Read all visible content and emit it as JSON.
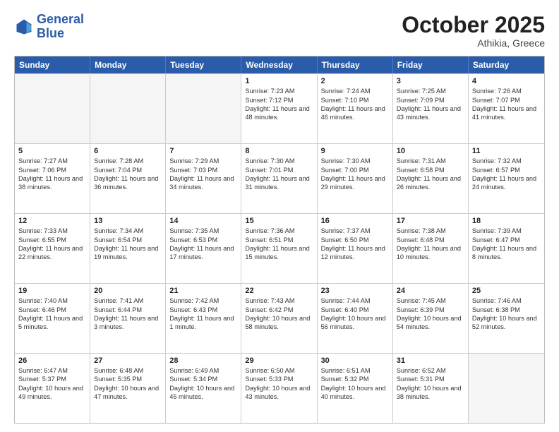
{
  "header": {
    "logo_line1": "General",
    "logo_line2": "Blue",
    "month": "October 2025",
    "location": "Athikia, Greece"
  },
  "days_of_week": [
    "Sunday",
    "Monday",
    "Tuesday",
    "Wednesday",
    "Thursday",
    "Friday",
    "Saturday"
  ],
  "rows": [
    [
      {
        "day": "",
        "empty": true
      },
      {
        "day": "",
        "empty": true
      },
      {
        "day": "",
        "empty": true
      },
      {
        "day": "1",
        "sunrise": "Sunrise: 7:23 AM",
        "sunset": "Sunset: 7:12 PM",
        "daylight": "Daylight: 11 hours and 48 minutes."
      },
      {
        "day": "2",
        "sunrise": "Sunrise: 7:24 AM",
        "sunset": "Sunset: 7:10 PM",
        "daylight": "Daylight: 11 hours and 46 minutes."
      },
      {
        "day": "3",
        "sunrise": "Sunrise: 7:25 AM",
        "sunset": "Sunset: 7:09 PM",
        "daylight": "Daylight: 11 hours and 43 minutes."
      },
      {
        "day": "4",
        "sunrise": "Sunrise: 7:26 AM",
        "sunset": "Sunset: 7:07 PM",
        "daylight": "Daylight: 11 hours and 41 minutes."
      }
    ],
    [
      {
        "day": "5",
        "sunrise": "Sunrise: 7:27 AM",
        "sunset": "Sunset: 7:06 PM",
        "daylight": "Daylight: 11 hours and 38 minutes."
      },
      {
        "day": "6",
        "sunrise": "Sunrise: 7:28 AM",
        "sunset": "Sunset: 7:04 PM",
        "daylight": "Daylight: 11 hours and 36 minutes."
      },
      {
        "day": "7",
        "sunrise": "Sunrise: 7:29 AM",
        "sunset": "Sunset: 7:03 PM",
        "daylight": "Daylight: 11 hours and 34 minutes."
      },
      {
        "day": "8",
        "sunrise": "Sunrise: 7:30 AM",
        "sunset": "Sunset: 7:01 PM",
        "daylight": "Daylight: 11 hours and 31 minutes."
      },
      {
        "day": "9",
        "sunrise": "Sunrise: 7:30 AM",
        "sunset": "Sunset: 7:00 PM",
        "daylight": "Daylight: 11 hours and 29 minutes."
      },
      {
        "day": "10",
        "sunrise": "Sunrise: 7:31 AM",
        "sunset": "Sunset: 6:58 PM",
        "daylight": "Daylight: 11 hours and 26 minutes."
      },
      {
        "day": "11",
        "sunrise": "Sunrise: 7:32 AM",
        "sunset": "Sunset: 6:57 PM",
        "daylight": "Daylight: 11 hours and 24 minutes."
      }
    ],
    [
      {
        "day": "12",
        "sunrise": "Sunrise: 7:33 AM",
        "sunset": "Sunset: 6:55 PM",
        "daylight": "Daylight: 11 hours and 22 minutes."
      },
      {
        "day": "13",
        "sunrise": "Sunrise: 7:34 AM",
        "sunset": "Sunset: 6:54 PM",
        "daylight": "Daylight: 11 hours and 19 minutes."
      },
      {
        "day": "14",
        "sunrise": "Sunrise: 7:35 AM",
        "sunset": "Sunset: 6:53 PM",
        "daylight": "Daylight: 11 hours and 17 minutes."
      },
      {
        "day": "15",
        "sunrise": "Sunrise: 7:36 AM",
        "sunset": "Sunset: 6:51 PM",
        "daylight": "Daylight: 11 hours and 15 minutes."
      },
      {
        "day": "16",
        "sunrise": "Sunrise: 7:37 AM",
        "sunset": "Sunset: 6:50 PM",
        "daylight": "Daylight: 11 hours and 12 minutes."
      },
      {
        "day": "17",
        "sunrise": "Sunrise: 7:38 AM",
        "sunset": "Sunset: 6:48 PM",
        "daylight": "Daylight: 11 hours and 10 minutes."
      },
      {
        "day": "18",
        "sunrise": "Sunrise: 7:39 AM",
        "sunset": "Sunset: 6:47 PM",
        "daylight": "Daylight: 11 hours and 8 minutes."
      }
    ],
    [
      {
        "day": "19",
        "sunrise": "Sunrise: 7:40 AM",
        "sunset": "Sunset: 6:46 PM",
        "daylight": "Daylight: 11 hours and 5 minutes."
      },
      {
        "day": "20",
        "sunrise": "Sunrise: 7:41 AM",
        "sunset": "Sunset: 6:44 PM",
        "daylight": "Daylight: 11 hours and 3 minutes."
      },
      {
        "day": "21",
        "sunrise": "Sunrise: 7:42 AM",
        "sunset": "Sunset: 6:43 PM",
        "daylight": "Daylight: 11 hours and 1 minute."
      },
      {
        "day": "22",
        "sunrise": "Sunrise: 7:43 AM",
        "sunset": "Sunset: 6:42 PM",
        "daylight": "Daylight: 10 hours and 58 minutes."
      },
      {
        "day": "23",
        "sunrise": "Sunrise: 7:44 AM",
        "sunset": "Sunset: 6:40 PM",
        "daylight": "Daylight: 10 hours and 56 minutes."
      },
      {
        "day": "24",
        "sunrise": "Sunrise: 7:45 AM",
        "sunset": "Sunset: 6:39 PM",
        "daylight": "Daylight: 10 hours and 54 minutes."
      },
      {
        "day": "25",
        "sunrise": "Sunrise: 7:46 AM",
        "sunset": "Sunset: 6:38 PM",
        "daylight": "Daylight: 10 hours and 52 minutes."
      }
    ],
    [
      {
        "day": "26",
        "sunrise": "Sunrise: 6:47 AM",
        "sunset": "Sunset: 5:37 PM",
        "daylight": "Daylight: 10 hours and 49 minutes."
      },
      {
        "day": "27",
        "sunrise": "Sunrise: 6:48 AM",
        "sunset": "Sunset: 5:35 PM",
        "daylight": "Daylight: 10 hours and 47 minutes."
      },
      {
        "day": "28",
        "sunrise": "Sunrise: 6:49 AM",
        "sunset": "Sunset: 5:34 PM",
        "daylight": "Daylight: 10 hours and 45 minutes."
      },
      {
        "day": "29",
        "sunrise": "Sunrise: 6:50 AM",
        "sunset": "Sunset: 5:33 PM",
        "daylight": "Daylight: 10 hours and 43 minutes."
      },
      {
        "day": "30",
        "sunrise": "Sunrise: 6:51 AM",
        "sunset": "Sunset: 5:32 PM",
        "daylight": "Daylight: 10 hours and 40 minutes."
      },
      {
        "day": "31",
        "sunrise": "Sunrise: 6:52 AM",
        "sunset": "Sunset: 5:31 PM",
        "daylight": "Daylight: 10 hours and 38 minutes."
      },
      {
        "day": "",
        "empty": true
      }
    ]
  ]
}
